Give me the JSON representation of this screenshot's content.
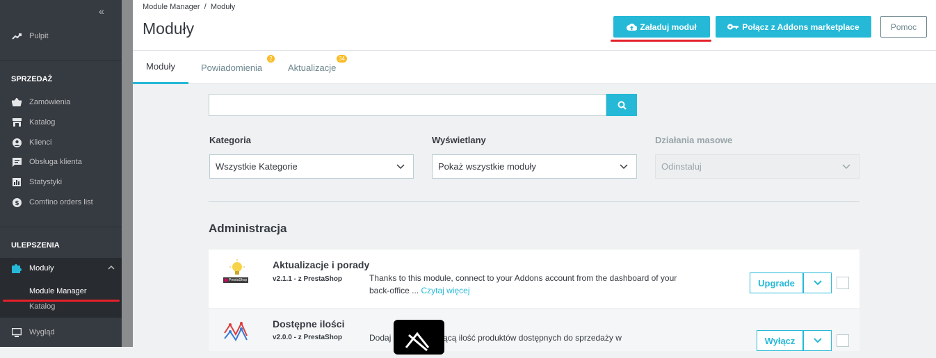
{
  "sidebar": {
    "collapse_icon": "«",
    "dashboard": "Pulpit",
    "section_sales": "SPRZEDAŻ",
    "sales_items": [
      "Zamówienia",
      "Katalog",
      "Klienci",
      "Obsługa klienta",
      "Statystyki",
      "Comfino orders list"
    ],
    "section_improve": "ULEPSZENIA",
    "modules": "Moduły",
    "sub_items": [
      "Module Manager",
      "Katalog"
    ],
    "appearance": "Wygląd"
  },
  "header": {
    "breadcrumb": "Module Manager  /  Moduły",
    "title": "Moduły",
    "upload_button": "Załaduj moduł",
    "connect_button": "Połącz z Addons marketplace",
    "help_button": "Pomoc"
  },
  "tabs": [
    {
      "label": "Moduły"
    },
    {
      "label": "Powiadomienia",
      "badge": "2"
    },
    {
      "label": "Aktualizacje",
      "badge": "34"
    }
  ],
  "filters": {
    "search_value": "",
    "category_label": "Kategoria",
    "category_value": "Wszystkie Kategorie",
    "display_label": "Wyświetlany",
    "display_value": "Pokaż wszystkie moduły",
    "bulk_label": "Działania masowe",
    "bulk_value": "Odinstaluj"
  },
  "section_title": "Administracja",
  "modules": [
    {
      "name": "Aktualizacje i porady",
      "version": "v2.1.1 - z PrestaShop",
      "description": "Thanks to this module, connect to your Addons account from the dashboard of your back-office ...",
      "read_more": "Czytaj więcej",
      "action": "Upgrade",
      "logo_text": "PrestaShop"
    },
    {
      "name": "Dostępne ilości",
      "version": "v2.0.0 - z PrestaShop",
      "description": "Dodaj          pokazującą ilość produktów dostępnych do sprzedaży w",
      "action": "Wyłącz"
    }
  ],
  "colors": {
    "accent": "#25b9d7",
    "sidebar": "#363a41",
    "highlight": "#e4202a",
    "badge": "#fbbb22"
  }
}
